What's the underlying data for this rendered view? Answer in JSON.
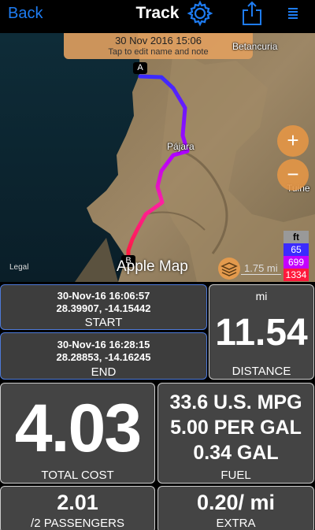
{
  "nav": {
    "back_label": "Back",
    "title": "Track"
  },
  "map": {
    "banner_date": "30 Nov 2016 15:06",
    "banner_hint": "Tap to edit name and note",
    "places": [
      "Betancuria",
      "Pájara",
      "Tuine"
    ],
    "marker_start": "A",
    "marker_end": "B",
    "zoom_in": "+",
    "zoom_out": "−",
    "legal": "Legal",
    "map_type": "Apple Map",
    "scale": "1.75 mi",
    "elevation_unit": "ft",
    "elevation_levels": [
      "65",
      "699",
      "1334"
    ],
    "colors": {
      "route_low": "#3b2bff",
      "route_mid": "#b400ff",
      "route_high": "#ff1a3c",
      "accent": "#e39a4d"
    }
  },
  "start": {
    "datetime": "30-Nov-16 16:06:57",
    "coords": "28.39907, -14.15442",
    "label": "START"
  },
  "end": {
    "datetime": "30-Nov-16 16:28:15",
    "coords": "28.28853, -14.16245",
    "label": "END"
  },
  "distance": {
    "unit": "mi",
    "value": "11.54",
    "label": "DISTANCE"
  },
  "cost": {
    "value": "4.03",
    "label": "TOTAL COST"
  },
  "fuel": {
    "mpg": "33.6 U.S. MPG",
    "price": "5.00 PER GAL",
    "gallons": "0.34 GAL",
    "label": "FUEL"
  },
  "passengers": {
    "value": "2.01",
    "label": "/2 PASSENGERS"
  },
  "extra": {
    "value": "0.20/ mi",
    "label": "EXTRA"
  }
}
